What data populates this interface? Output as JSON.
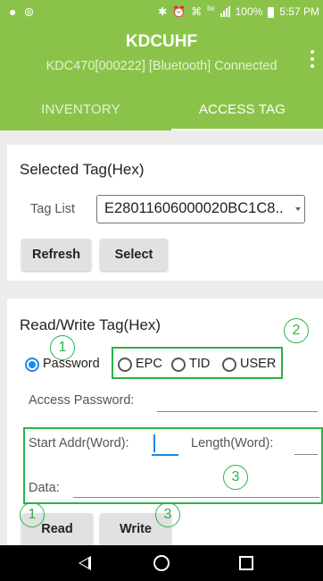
{
  "status_bar": {
    "left_icons": [
      "location-icon",
      "voicemail-icon"
    ],
    "battery": "100%",
    "time": "5:57 PM",
    "network": "lte"
  },
  "app_bar": {
    "title": "KDCUHF",
    "subtitle": "KDC470[000222] [Bluetooth] Connected"
  },
  "tabs": [
    {
      "label": "INVENTORY",
      "selected": false
    },
    {
      "label": "ACCESS TAG",
      "selected": true
    }
  ],
  "selected_tag": {
    "title": "Selected Tag(Hex)",
    "tag_list_label": "Tag List",
    "tag_list_value": "E28011606000020BC1C8..",
    "refresh_label": "Refresh",
    "select_label": "Select"
  },
  "read_write": {
    "title": "Read/Write Tag(Hex)",
    "memory_options": [
      {
        "label": "Password",
        "checked": true
      },
      {
        "label": "EPC",
        "checked": false
      },
      {
        "label": "TID",
        "checked": false
      },
      {
        "label": "USER",
        "checked": false
      }
    ],
    "access_password_label": "Access Password:",
    "access_password_value": "",
    "start_addr_label": "Start Addr(Word):",
    "start_addr_value": "",
    "length_label": "Length(Word):",
    "length_value": "",
    "data_label": "Data:",
    "data_value": "",
    "read_label": "Read",
    "write_label": "Write"
  },
  "annotations": [
    "1",
    "2",
    "3",
    "1",
    "3"
  ],
  "colors": {
    "app_bar": "#8bc34a",
    "radio_accent": "#1e88e5",
    "annotation": "#29b34a"
  }
}
